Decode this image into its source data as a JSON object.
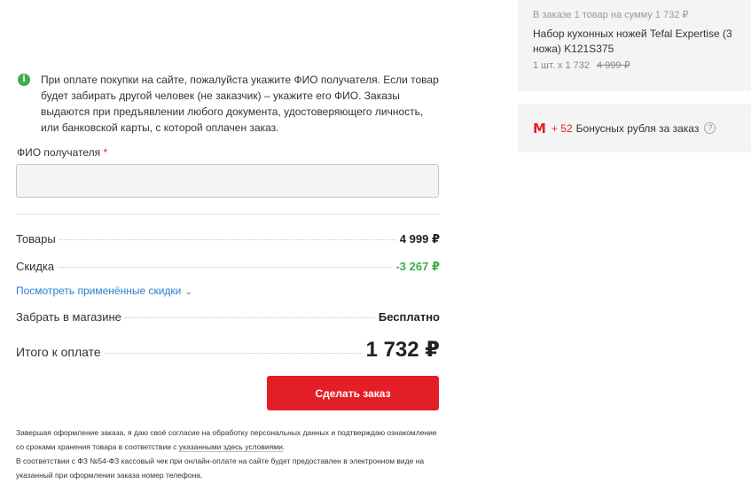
{
  "notice": {
    "text": "При оплате покупки на сайте, пожалуйста укажите ФИО получателя. Если товар будет забирать другой человек (не заказчик) – укажите его ФИО. Заказы выдаются при предъявлении любого документа, удостоверяющего личность, или банковской карты, с которой оплачен заказ."
  },
  "recipient": {
    "label": "ФИО получателя",
    "required_mark": "*",
    "value": ""
  },
  "totals": {
    "goods_label": "Товары",
    "goods_value": "4 999 ₽",
    "discount_label": "Скидка",
    "discount_value": "-3 267 ₽",
    "discount_link": "Посмотреть применённые скидки",
    "pickup_label": "Забрать в магазине",
    "pickup_value": "Бесплатно",
    "total_label": "Итого к оплате",
    "total_value": "1 732 ₽"
  },
  "order_button": "Сделать заказ",
  "legal": {
    "consent_start": "Завершая оформление заказа, я даю своё согласие на обработку персональных данных и подтверждаю ознакомление со сроками хранения товара в соответствии с ",
    "consent_link": "указанными здесь условиями",
    "consent_end": ".",
    "receipt_line": "В соответствии с ФЗ №54-ФЗ кассовый чек при онлайн-оплате на сайте будет предоставлен в электронном виде на указанный при оформлении заказа номер телефона."
  },
  "summary": {
    "head": "В заказе 1 товар на сумму 1 732 ₽",
    "product_name": "Набор кухонных ножей Tefal Expertise (3 ножа) K121S375",
    "qty": "1 шт. x 1 732",
    "old_price": "4 999 ₽"
  },
  "bonus": {
    "icon": "М",
    "plus": "+ 52",
    "text": "Бонусных рубля за заказ",
    "help": "?"
  },
  "colors": {
    "accent_red": "#e41e26",
    "discount_green": "#3cae4d",
    "link_blue": "#2d7dd2"
  }
}
